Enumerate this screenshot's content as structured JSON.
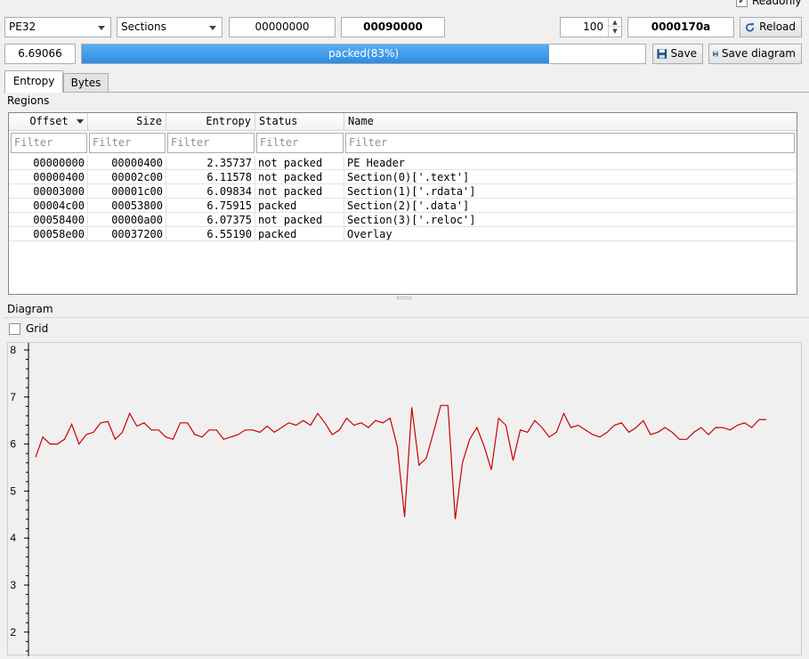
{
  "toolbar": {
    "file_type": "PE32",
    "mode": "Sections",
    "offset_start": "00000000",
    "offset_end": "00090000",
    "count": "100",
    "block_size": "0000170a",
    "reload_label": "Reload",
    "readonly_label": "Readonly",
    "readonly_checked": true
  },
  "status": {
    "total_entropy": "6.69066",
    "progress_text": "packed(83%)",
    "progress_fraction": 0.83,
    "save_label": "Save",
    "save_diagram_label": "Save diagram"
  },
  "tabs": [
    {
      "label": "Entropy",
      "active": true
    },
    {
      "label": "Bytes",
      "active": false
    }
  ],
  "regions": {
    "title": "Regions",
    "columns": [
      "Offset",
      "Size",
      "Entropy",
      "Status",
      "Name"
    ],
    "filter_placeholder": "Filter",
    "rows": [
      {
        "offset": "00000000",
        "size": "00000400",
        "entropy": "2.35737",
        "status": "not packed",
        "name": "PE Header"
      },
      {
        "offset": "00000400",
        "size": "00002c00",
        "entropy": "6.11578",
        "status": "not packed",
        "name": "Section(0)['.text']"
      },
      {
        "offset": "00003000",
        "size": "00001c00",
        "entropy": "6.09834",
        "status": "not packed",
        "name": "Section(1)['.rdata']"
      },
      {
        "offset": "00004c00",
        "size": "00053800",
        "entropy": "6.75915",
        "status": "packed",
        "name": "Section(2)['.data']"
      },
      {
        "offset": "00058400",
        "size": "00000a00",
        "entropy": "6.07375",
        "status": "not packed",
        "name": "Section(3)['.reloc']"
      },
      {
        "offset": "00058e00",
        "size": "00037200",
        "entropy": "6.55190",
        "status": "packed",
        "name": "Overlay"
      }
    ]
  },
  "diagram": {
    "title": "Diagram",
    "grid_label": "Grid",
    "grid_checked": false
  },
  "colors": {
    "line": "#cc0000",
    "progress": "#3c96e8"
  },
  "chart_data": {
    "type": "line",
    "ylim": [
      1.5,
      8
    ],
    "yticks": [
      2,
      3,
      4,
      5,
      6,
      7,
      8
    ],
    "grid": false,
    "series": [
      {
        "values": [
          5.72,
          6.15,
          6.0,
          6.0,
          6.1,
          6.42,
          6.0,
          6.2,
          6.25,
          6.45,
          6.48,
          6.1,
          6.25,
          6.65,
          6.38,
          6.45,
          6.3,
          6.3,
          6.15,
          6.1,
          6.45,
          6.45,
          6.2,
          6.15,
          6.3,
          6.3,
          6.1,
          6.15,
          6.2,
          6.3,
          6.3,
          6.25,
          6.38,
          6.25,
          6.35,
          6.45,
          6.4,
          6.5,
          6.4,
          6.65,
          6.45,
          6.2,
          6.3,
          6.55,
          6.4,
          6.45,
          6.35,
          6.5,
          6.45,
          6.55,
          5.95,
          4.45,
          6.78,
          5.55,
          5.7,
          6.25,
          6.82,
          6.82,
          4.4,
          5.6,
          6.1,
          6.35,
          5.95,
          5.45,
          6.55,
          6.4,
          5.65,
          6.3,
          6.25,
          6.5,
          6.35,
          6.15,
          6.25,
          6.65,
          6.35,
          6.4,
          6.3,
          6.2,
          6.15,
          6.25,
          6.4,
          6.45,
          6.25,
          6.35,
          6.5,
          6.2,
          6.25,
          6.35,
          6.25,
          6.1,
          6.1,
          6.25,
          6.35,
          6.2,
          6.35,
          6.35,
          6.3,
          6.4,
          6.45,
          6.35,
          6.52,
          6.52
        ]
      }
    ]
  }
}
